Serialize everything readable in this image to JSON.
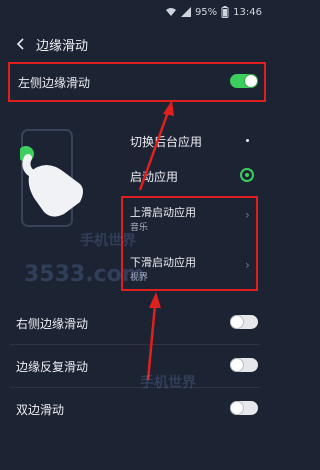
{
  "status": {
    "battery": "95%",
    "time": "13:46"
  },
  "header": {
    "title": "边缘滑动"
  },
  "left_edge": {
    "label": "左侧边缘滑动",
    "enabled": true
  },
  "options": [
    {
      "label": "切换后台应用",
      "selected": false
    },
    {
      "label": "启动应用",
      "selected": true
    }
  ],
  "launch_items": [
    {
      "title": "上滑启动应用",
      "sub": "音乐"
    },
    {
      "title": "下滑启动应用",
      "sub": "视界"
    }
  ],
  "other_settings": [
    {
      "label": "右侧边缘滑动",
      "enabled": false
    },
    {
      "label": "边缘反复滑动",
      "enabled": false
    },
    {
      "label": "双边滑动",
      "enabled": false
    }
  ],
  "watermark": {
    "text": "3533.com",
    "cn": "手机世界"
  },
  "colors": {
    "background": "#1c2333",
    "toggle_on": "#3ccf5e",
    "highlight": "#e01f1f"
  }
}
